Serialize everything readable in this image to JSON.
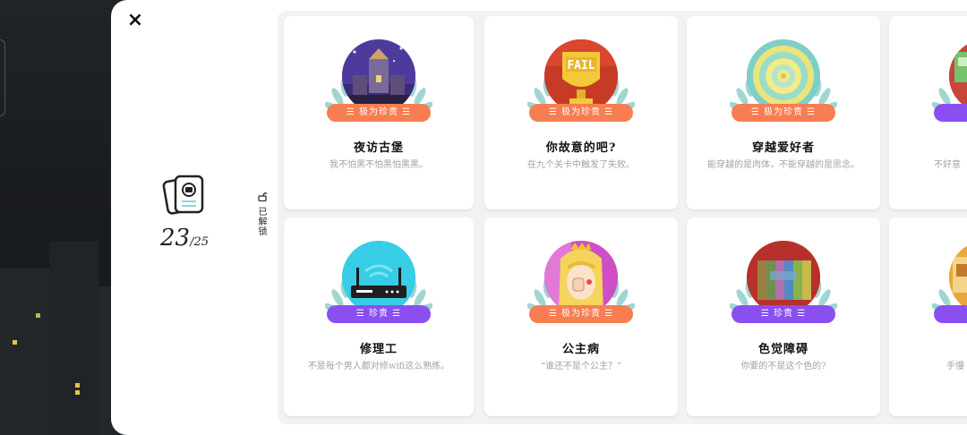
{
  "modal": {
    "close_label": "×"
  },
  "summary": {
    "unlocked_count": "23",
    "total": "/25"
  },
  "unlocked_label": "已解锁",
  "colors": {
    "orange_ribbon": "#f77d52",
    "purple_ribbon": "#8a4ff0",
    "leaf": "#9fd6d2"
  },
  "cards": [
    {
      "title": "夜访古堡",
      "desc": "我不怕黑不怕黑怕黑黑。",
      "tag": "极为珍贵",
      "rarity": "orange",
      "icon": "castle-night-icon"
    },
    {
      "title": "你故意的吧?",
      "desc": "在九个关卡中触发了失败。",
      "tag": "极为珍贵",
      "rarity": "orange",
      "icon": "fail-trophy-icon"
    },
    {
      "title": "穿越爱好者",
      "desc": "能穿越的是肉体，不能穿越的是思念。",
      "tag": "极为珍贵",
      "rarity": "orange",
      "icon": "portal-icon"
    },
    {
      "title": "",
      "desc": "不好意",
      "tag": "",
      "rarity": "purple",
      "icon": "partial-icon"
    },
    {
      "title": "修理工",
      "desc": "不是每个男人都对修wifi这么熟练。",
      "tag": "珍贵",
      "rarity": "purple",
      "icon": "router-icon"
    },
    {
      "title": "公主病",
      "desc": "“谁还不是个公主？”",
      "tag": "极为珍贵",
      "rarity": "orange",
      "icon": "princess-icon"
    },
    {
      "title": "色觉障碍",
      "desc": "你要的不是这个色的?",
      "tag": "珍贵",
      "rarity": "purple",
      "icon": "color-blocks-icon"
    },
    {
      "title": "",
      "desc": "手慢",
      "tag": "",
      "rarity": "purple",
      "icon": "partial-icon"
    }
  ]
}
